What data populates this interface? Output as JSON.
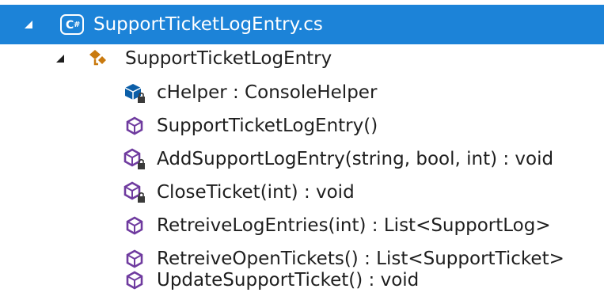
{
  "tree": {
    "file": {
      "label": "SupportTicketLogEntry.cs",
      "icon": "csharp-file-icon",
      "expanded": true,
      "selected": true
    },
    "class": {
      "label": "SupportTicketLogEntry",
      "icon": "class-icon",
      "expanded": true
    },
    "members": [
      {
        "label": "cHelper : ConsoleHelper",
        "icon": "private-field-icon"
      },
      {
        "label": "SupportTicketLogEntry()",
        "icon": "method-icon"
      },
      {
        "label": "AddSupportLogEntry(string, bool, int) : void",
        "icon": "private-method-icon"
      },
      {
        "label": "CloseTicket(int) : void",
        "icon": "private-method-icon"
      },
      {
        "label": "RetreiveLogEntries(int) : List<SupportLog>",
        "icon": "method-icon"
      },
      {
        "label": "RetreiveOpenTickets() : List<SupportTicket>",
        "icon": "method-icon"
      },
      {
        "label": "UpdateSupportTicket() : void",
        "icon": "method-icon"
      }
    ]
  },
  "colors": {
    "selection": "#1c83d8",
    "method": "#6f3b9f",
    "field": "#0b5ea8",
    "class": "#c97a0f",
    "text": "#1e1e1e"
  }
}
